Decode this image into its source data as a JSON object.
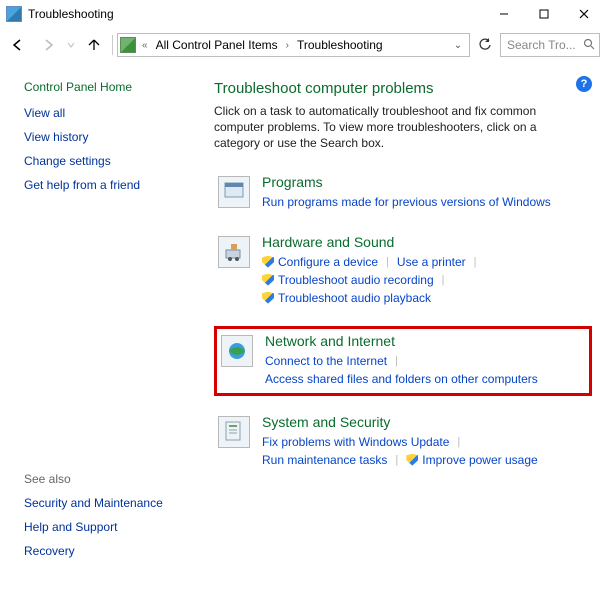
{
  "titlebar": {
    "title": "Troubleshooting"
  },
  "breadcrumb": {
    "items": [
      "All Control Panel Items",
      "Troubleshooting"
    ]
  },
  "search": {
    "placeholder": "Search Tro..."
  },
  "sidebar": {
    "home": "Control Panel Home",
    "links": [
      "View all",
      "View history",
      "Change settings",
      "Get help from a friend"
    ],
    "see_also_label": "See also",
    "see_also": [
      "Security and Maintenance",
      "Help and Support",
      "Recovery"
    ]
  },
  "content": {
    "heading": "Troubleshoot computer problems",
    "description": "Click on a task to automatically troubleshoot and fix common computer problems. To view more troubleshooters, click on a category or use the Search box."
  },
  "sections": {
    "programs": {
      "title": "Programs",
      "links": [
        {
          "label": "Run programs made for previous versions of Windows",
          "shield": false
        }
      ]
    },
    "hardware": {
      "title": "Hardware and Sound",
      "links": [
        {
          "label": "Configure a device",
          "shield": true
        },
        {
          "label": "Use a printer",
          "shield": false
        },
        {
          "label": "Troubleshoot audio recording",
          "shield": true
        },
        {
          "label": "Troubleshoot audio playback",
          "shield": true
        }
      ]
    },
    "network": {
      "title": "Network and Internet",
      "links": [
        {
          "label": "Connect to the Internet",
          "shield": false
        },
        {
          "label": "Access shared files and folders on other computers",
          "shield": false
        }
      ]
    },
    "system": {
      "title": "System and Security",
      "links": [
        {
          "label": "Fix problems with Windows Update",
          "shield": false
        },
        {
          "label": "Run maintenance tasks",
          "shield": false
        },
        {
          "label": "Improve power usage",
          "shield": true
        }
      ]
    }
  }
}
